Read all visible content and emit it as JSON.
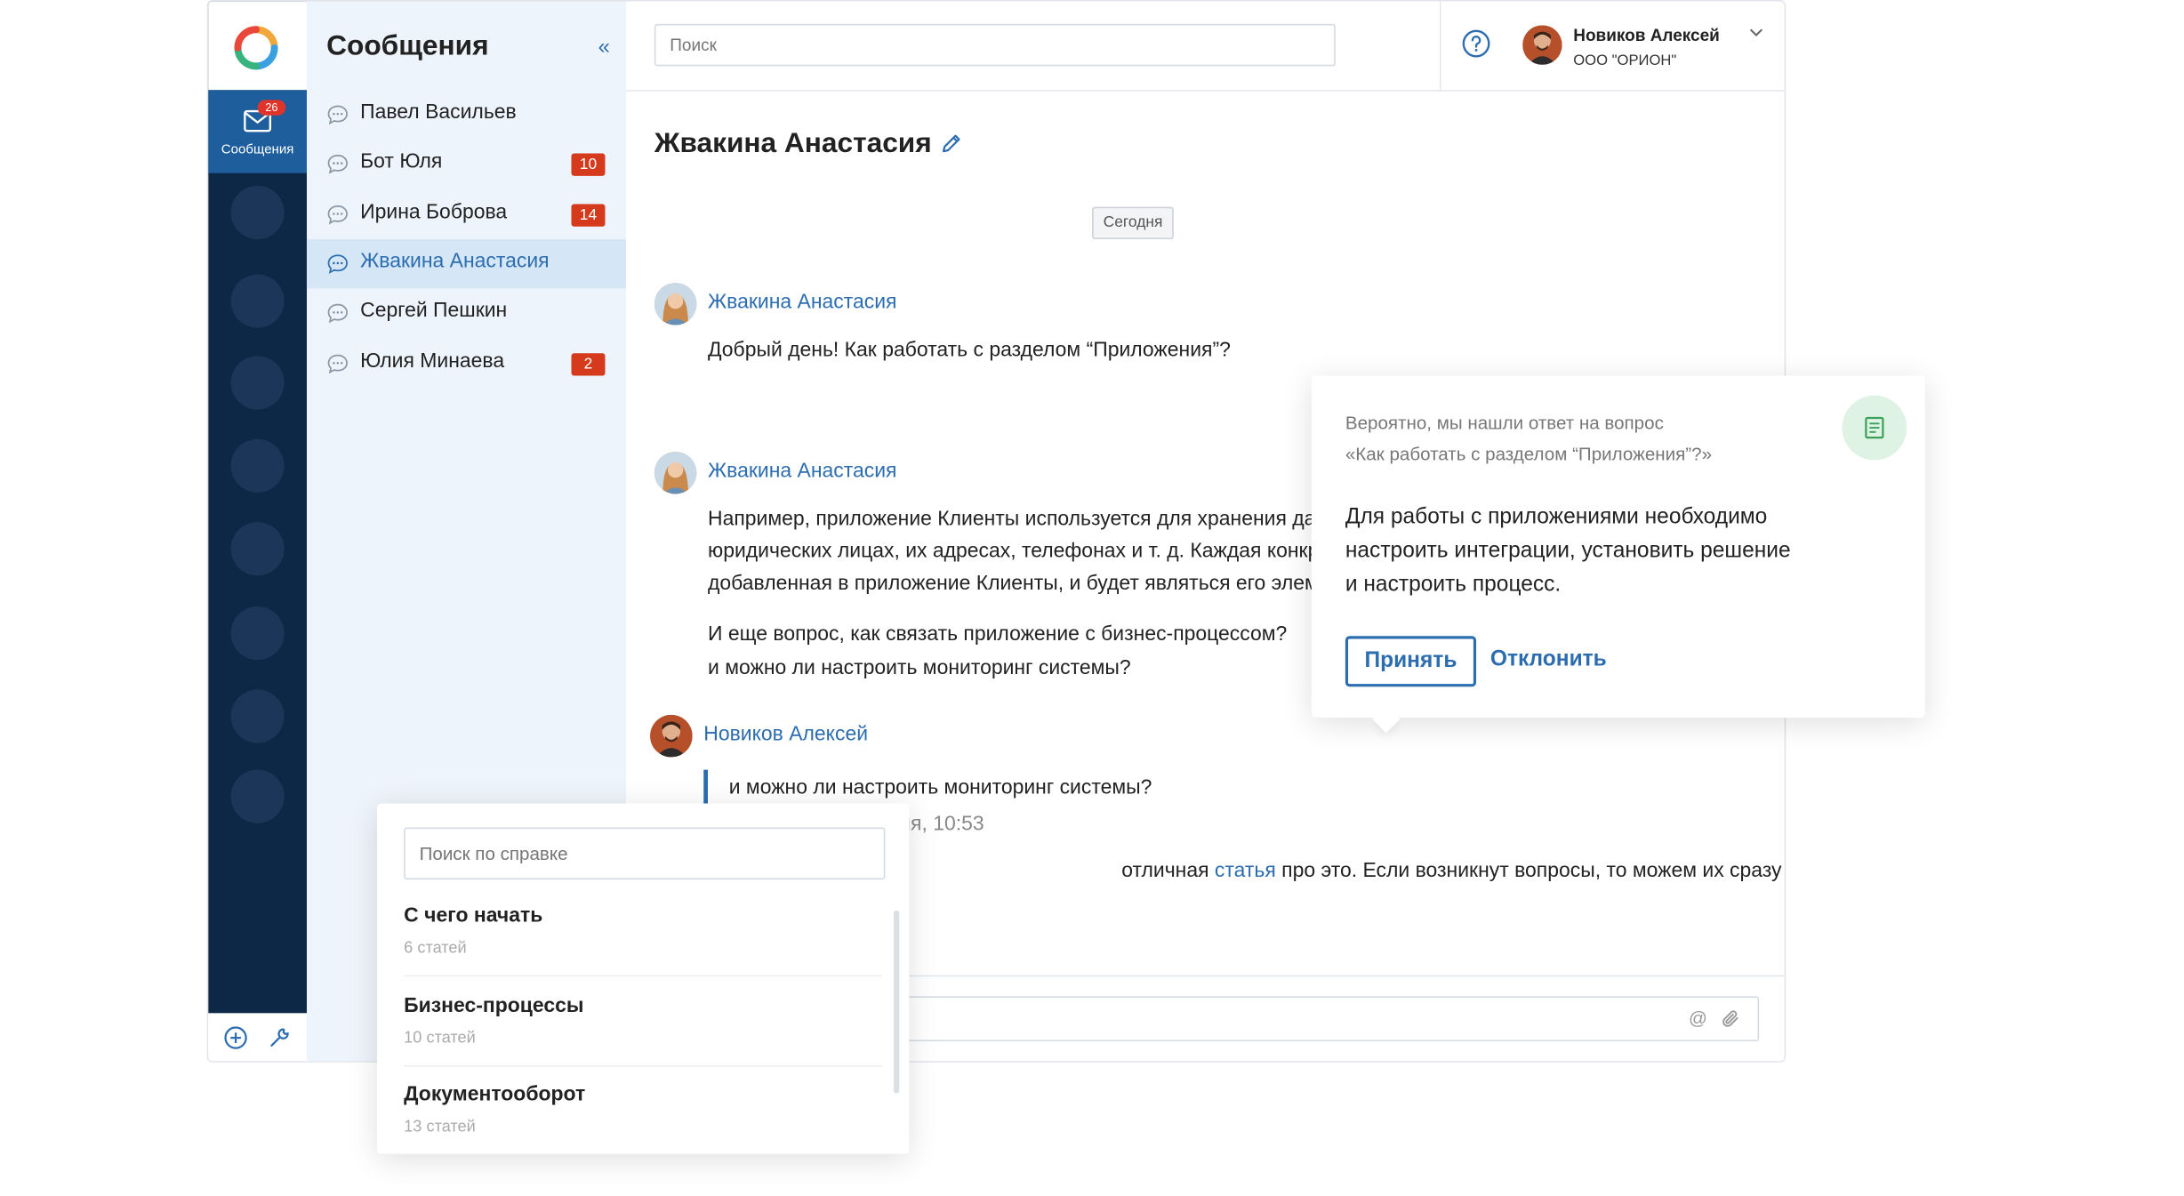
{
  "rail": {
    "active_label": "Сообщения",
    "badge": "26"
  },
  "list": {
    "title": "Сообщения",
    "items": [
      {
        "name": "Павел Васильев",
        "count": ""
      },
      {
        "name": "Бот Юля",
        "count": "10"
      },
      {
        "name": "Ирина Боброва",
        "count": "14"
      },
      {
        "name": "Жвакина Анастасия",
        "count": ""
      },
      {
        "name": "Сергей Пешкин",
        "count": ""
      },
      {
        "name": "Юлия Минаева",
        "count": "2"
      }
    ]
  },
  "topbar": {
    "search_placeholder": "Поиск",
    "user_name": "Новиков Алексей",
    "user_org": "ООО \"ОРИОН\""
  },
  "chat": {
    "title": "Жвакина Анастасия",
    "date_chip": "Сегодня",
    "msg1_author": "Жвакина Анастасия",
    "msg1_text": "Добрый день! Как работать с разделом “Приложения”?",
    "msg2_author": "Жвакина Анастасия",
    "msg2_line1": "Например, приложение Клиенты используется для хранения да",
    "msg2_line2": "юридических лицах, их адресах, телефонах и т. д. Каждая конкр",
    "msg2_line3": "добавленная в приложение Клиенты, и будет являться его элеме",
    "msg2_line4": "И еще вопрос, как связать приложение с бизнес-процессом?",
    "msg2_line5": "и можно ли настроить мониторинг системы?",
    "msg3_author": "Новиков Алексей",
    "msg3_quote": "и можно ли настроить мониторинг системы?",
    "msg3_time": "ия, 10:53",
    "msg3_pre": "отличная ",
    "msg3_link": "статья",
    "msg3_post": " про это. Если возникнут вопросы, то можем их сразу"
  },
  "suggestion": {
    "q_line1": "Вероятно, мы нашли ответ на вопрос",
    "q_line2": "«Как работать с разделом “Приложения”?»",
    "ans_line1": "Для работы с приложениями необходимо",
    "ans_line2": "настроить интеграции, установить решение",
    "ans_line3": "и настроить процесс.",
    "accept": "Принять",
    "decline": "Отклонить"
  },
  "help": {
    "search_placeholder": "Поиск по справке",
    "sections": [
      {
        "title": "С чего начать",
        "sub": "6 статей"
      },
      {
        "title": "Бизнес-процессы",
        "sub": "10 статей"
      },
      {
        "title": "Документооборот",
        "sub": "13 статей"
      }
    ]
  },
  "colors": {
    "rail": "#0d2746",
    "accent": "#2c6db0",
    "badge": "#d53a1c",
    "list_bg": "#eef4fb"
  }
}
